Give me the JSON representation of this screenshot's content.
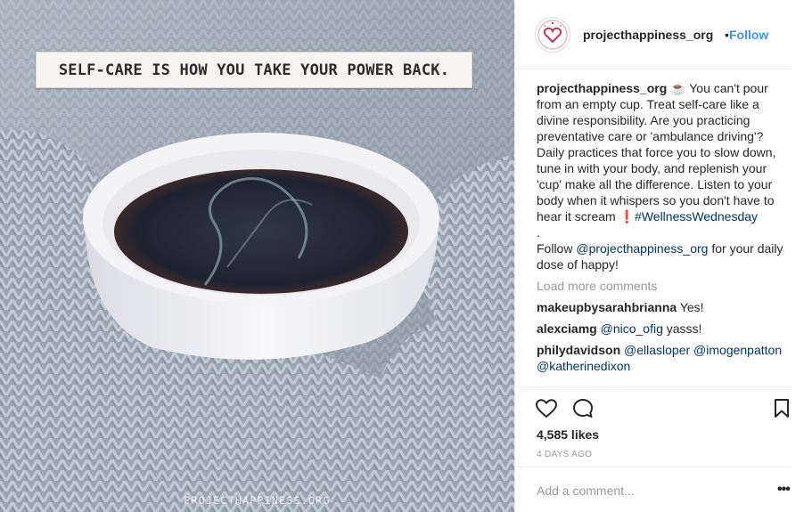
{
  "image": {
    "quote": "SELF-CARE IS HOW YOU TAKE YOUR POWER BACK.",
    "watermark": "PROJECTHAPPINESS.ORG"
  },
  "header": {
    "username": "projecthappiness_org",
    "separator": "•",
    "follow_label": "Follow"
  },
  "caption": {
    "username": "projecthappiness_org",
    "emoji": "☕",
    "text": "You can't pour from an empty cup. Treat self-care like a divine responsibility. Are you practicing preventative care or 'ambulance driving'? Daily practices that force you to slow down, tune in with your body, and replenish your 'cup' make all the difference. Listen to your body when it whispers so you don't have to hear it scream",
    "exclamation": "❗",
    "hashtag": "#WellnessWednesday",
    "dot_line": ".",
    "follow_prefix": "Follow ",
    "follow_mention": "@projecthappiness_org",
    "follow_suffix": " for your daily dose of happy!"
  },
  "load_more_label": "Load more comments",
  "comments": [
    {
      "username": "makeupbysarahbrianna",
      "text": "Yes!"
    },
    {
      "username": "alexciamg",
      "mention": "@nico_ofig",
      "text": " yasss!"
    },
    {
      "username": "philydavidson",
      "mention": "@ellasloper",
      "mention2": "@imogenpatton",
      "mention3": "@katherinedixon"
    }
  ],
  "actions": {
    "like_icon": "heart-icon",
    "comment_icon": "comment-bubble-icon",
    "save_icon": "bookmark-icon",
    "likes": "4,585 likes",
    "date": "4 DAYS AGO"
  },
  "add_comment": {
    "placeholder": "Add a comment...",
    "more_icon": "more-options-icon",
    "more_label": "•••"
  },
  "colors": {
    "link_blue": "#3897f0",
    "mention_navy": "#003569",
    "muted_gray": "#999999",
    "alert_red": "#d0021b"
  }
}
